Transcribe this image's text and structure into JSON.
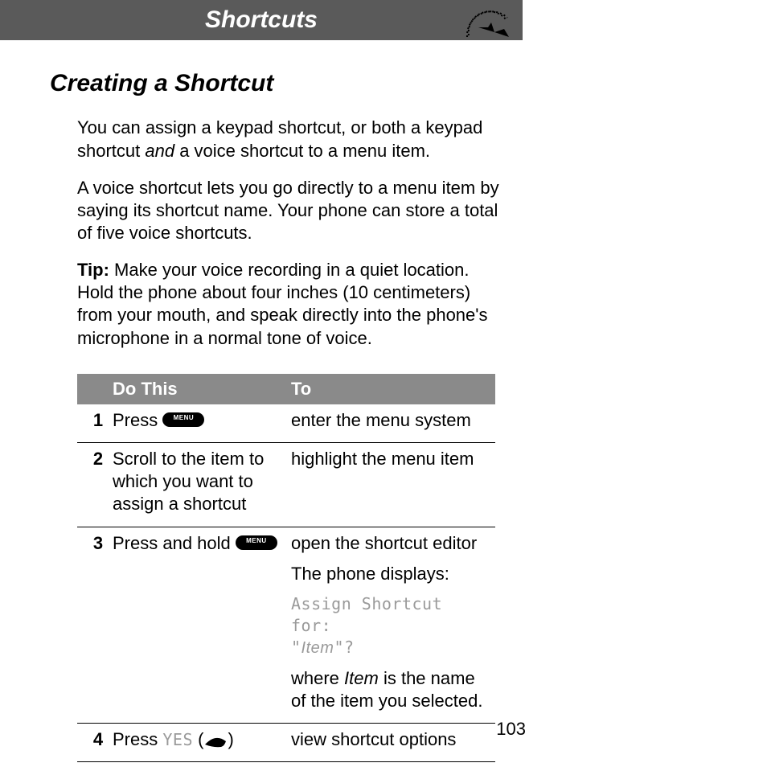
{
  "header": {
    "title": "Shortcuts"
  },
  "section": {
    "title": "Creating a Shortcut"
  },
  "paragraphs": {
    "p1_a": "You can assign a keypad shortcut, or both a keypad shortcut ",
    "p1_b": "and",
    "p1_c": " a voice shortcut to a menu item.",
    "p2": "A voice shortcut lets you go directly to a menu item by saying its shortcut name. Your phone can store a total of five voice shortcuts.",
    "tip_label": "Tip:",
    "tip_body": " Make your voice recording in a quiet location. Hold the phone about four inches (10 centimeters) from your mouth, and speak directly into the phone's microphone in a normal tone of voice."
  },
  "table": {
    "head_do": "Do This",
    "head_to": "To",
    "rows": [
      {
        "n": "1",
        "do_prefix": "Press ",
        "do_key": "MENU",
        "to": "enter the menu system"
      },
      {
        "n": "2",
        "do_text": "Scroll to the item to which you want to assign a shortcut",
        "to": "highlight the menu item"
      },
      {
        "n": "3",
        "do_prefix": "Press and hold ",
        "do_key": "MENU",
        "to_line1": "open the shortcut editor",
        "to_line2": "The phone displays:",
        "to_confirm_a": "Assign Shortcut for:",
        "to_confirm_b_open": "\"",
        "to_confirm_b_item": "Item",
        "to_confirm_b_close": "\"?",
        "to_line4_a": "where ",
        "to_line4_b": "Item",
        "to_line4_c": " is the name of the item you selected."
      },
      {
        "n": "4",
        "do_prefix": "Press ",
        "do_yes": "YES",
        "do_paren_open": " (",
        "do_paren_close": ")",
        "to": "view shortcut options"
      }
    ]
  },
  "page_number": "103"
}
